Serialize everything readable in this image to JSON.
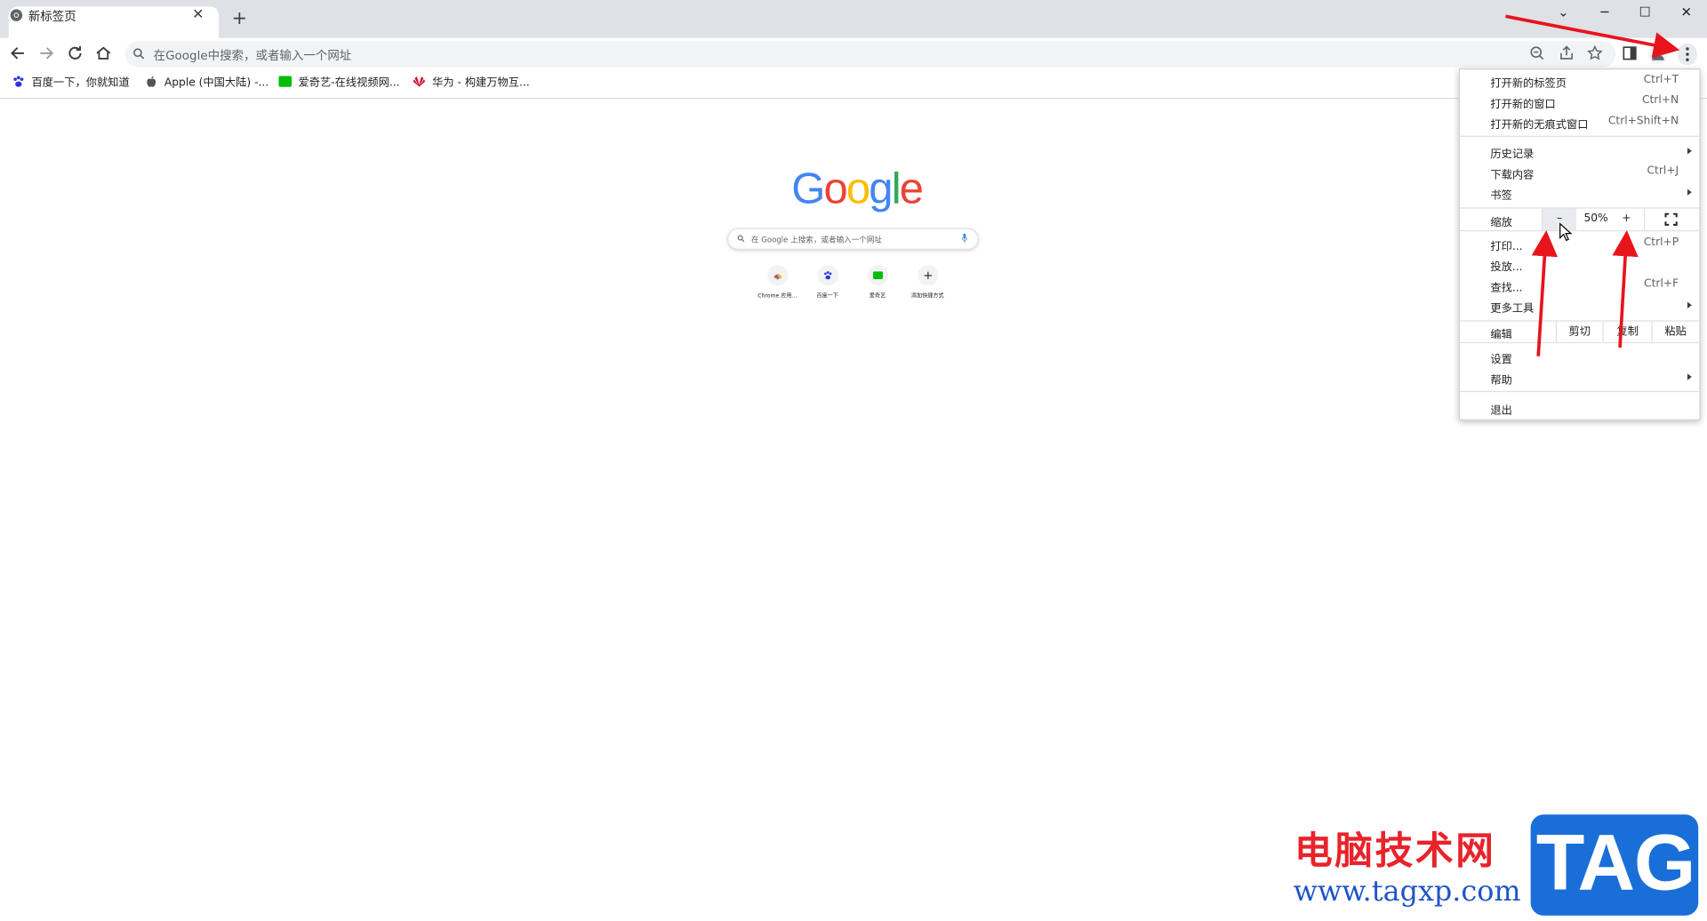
{
  "tab": {
    "title": "新标签页",
    "close": "✕",
    "new_tab": "+"
  },
  "window": {
    "dropdown": "⌄",
    "minimize": "─",
    "maximize": "☐",
    "close": "✕"
  },
  "omnibox": {
    "placeholder": "在Google中搜索，或者输入一个网址"
  },
  "bookmarks": [
    {
      "label": "百度一下，你就知道"
    },
    {
      "label": "Apple (中国大陆) -..."
    },
    {
      "label": "爱奇艺-在线视频网..."
    },
    {
      "label": "华为 - 构建万物互..."
    }
  ],
  "ntp": {
    "logo": [
      "G",
      "o",
      "o",
      "g",
      "l",
      "e"
    ],
    "logo_colors": [
      "#4285f4",
      "#ea4335",
      "#fbbc05",
      "#4285f4",
      "#34a853",
      "#ea4335"
    ],
    "search_placeholder": "在 Google 上搜索，或者输入一个网址",
    "shortcuts": [
      {
        "label": "Chrome 应用..."
      },
      {
        "label": "百度一下"
      },
      {
        "label": "爱奇艺"
      },
      {
        "label": "添加快捷方式",
        "icon": "+"
      }
    ]
  },
  "menu": {
    "new_tab": {
      "label": "打开新的标签页",
      "shortcut": "Ctrl+T"
    },
    "new_window": {
      "label": "打开新的窗口",
      "shortcut": "Ctrl+N"
    },
    "incognito": {
      "label": "打开新的无痕式窗口",
      "shortcut": "Ctrl+Shift+N"
    },
    "history": {
      "label": "历史记录"
    },
    "downloads": {
      "label": "下载内容",
      "shortcut": "Ctrl+J"
    },
    "bookmarks": {
      "label": "书签"
    },
    "zoom": {
      "label": "缩放",
      "minus": "–",
      "value": "50%",
      "plus": "+"
    },
    "print": {
      "label": "打印...",
      "shortcut": "Ctrl+P"
    },
    "cast": {
      "label": "投放..."
    },
    "find": {
      "label": "查找...",
      "shortcut": "Ctrl+F"
    },
    "more_tools": {
      "label": "更多工具"
    },
    "edit": {
      "label": "编辑",
      "cut": "剪切",
      "copy": "复制",
      "paste": "粘贴"
    },
    "settings": {
      "label": "设置"
    },
    "help": {
      "label": "帮助"
    },
    "exit": {
      "label": "退出"
    }
  },
  "watermark": {
    "site_name": "电脑技术网",
    "url": "www.tagxp.com",
    "tag": "TAG"
  },
  "colors": {
    "annotation_red": "#e8141c",
    "tabstrip": "#dee1e6",
    "accent_blue": "#1a73e8"
  }
}
